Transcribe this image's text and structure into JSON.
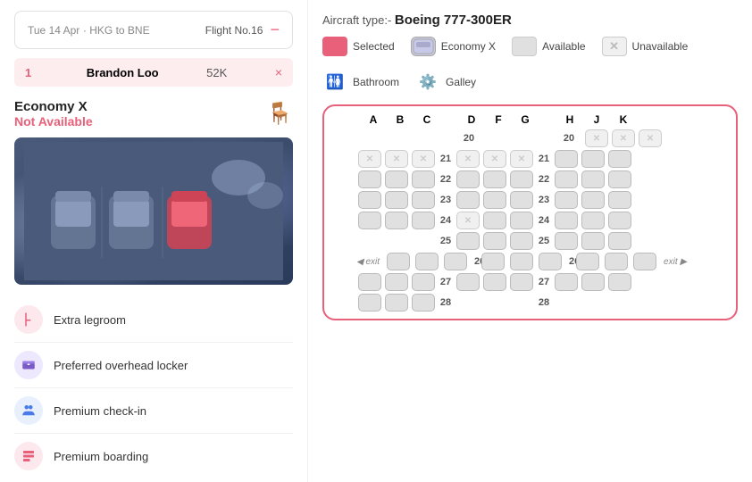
{
  "left": {
    "flight": {
      "date": "Tue 14 Apr",
      "route": "HKG to BNE",
      "flight_no_label": "Flight No.",
      "flight_no": "16",
      "minus": "−"
    },
    "passenger": {
      "num": "1",
      "name": "Brandon Loo",
      "seat": "52K",
      "x": "×"
    },
    "economy": {
      "title1": "Economy X",
      "title2": "Not Available"
    },
    "features": [
      {
        "label": "Extra legroom",
        "icon": "🦵",
        "color": "pink"
      },
      {
        "label": "Preferred overhead locker",
        "icon": "🧳",
        "color": "purple"
      },
      {
        "label": "Premium check-in",
        "icon": "👥",
        "color": "blue"
      },
      {
        "label": "Premium boarding",
        "icon": "🪑",
        "color": "pink"
      }
    ]
  },
  "right": {
    "aircraft_label": "Aircraft type:- ",
    "aircraft_name": "Boeing 777-300ER",
    "legend": [
      {
        "type": "selected",
        "label": "Selected"
      },
      {
        "type": "economy-x",
        "label": "Economy X"
      },
      {
        "type": "available",
        "label": "Available"
      },
      {
        "type": "unavailable",
        "label": "Unavailable"
      },
      {
        "type": "bathroom",
        "label": "Bathroom"
      },
      {
        "type": "galley",
        "label": "Galley"
      }
    ],
    "col_headers": [
      "A",
      "B",
      "C",
      "",
      "D",
      "F",
      "G",
      "",
      "H",
      "J",
      "K"
    ],
    "exit_label": "exit"
  }
}
